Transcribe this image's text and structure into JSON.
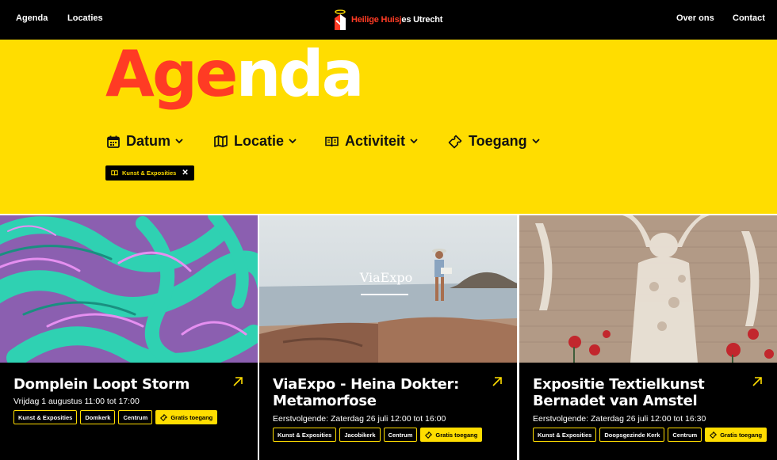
{
  "nav": {
    "agenda": "Agenda",
    "locaties": "Locaties",
    "over_ons": "Over ons",
    "contact": "Contact",
    "logo_red": "Heilige Huisj",
    "logo_white": "es Utrecht"
  },
  "hero": {
    "title_red": "Age",
    "title_white": "nda",
    "filters": [
      {
        "label": "Datum",
        "icon": "calendar-icon"
      },
      {
        "label": "Locatie",
        "icon": "map-icon"
      },
      {
        "label": "Activiteit",
        "icon": "book-icon"
      },
      {
        "label": "Toegang",
        "icon": "ticket-icon"
      }
    ],
    "active_filter": "Kunst & Exposities"
  },
  "cards": [
    {
      "title": "Domplein Loopt Storm",
      "date": "Vrijdag 1 augustus 11:00 tot 17:00",
      "tags": [
        "Kunst & Exposities",
        "Domkerk",
        "Centrum"
      ],
      "access": "Gratis toegang"
    },
    {
      "title": "ViaExpo - Heina Dokter: Metamorfose",
      "date": "Eerstvolgende: Zaterdag 26 juli 12:00 tot 16:00",
      "image_text": "ViaExpo",
      "tags": [
        "Kunst & Exposities",
        "Jacobikerk",
        "Centrum"
      ],
      "access": "Gratis toegang"
    },
    {
      "title": "Expositie Textielkunst Bernadet van Amstel",
      "date": "Eerstvolgende: Zaterdag 26 juli 12:00 tot 16:30",
      "tags": [
        "Kunst & Exposities",
        "Doopsgezinde Kerk",
        "Centrum"
      ],
      "access": "Gratis toegang"
    }
  ],
  "colors": {
    "yellow": "#ffdd00",
    "red": "#ff3b24",
    "black": "#000000"
  }
}
